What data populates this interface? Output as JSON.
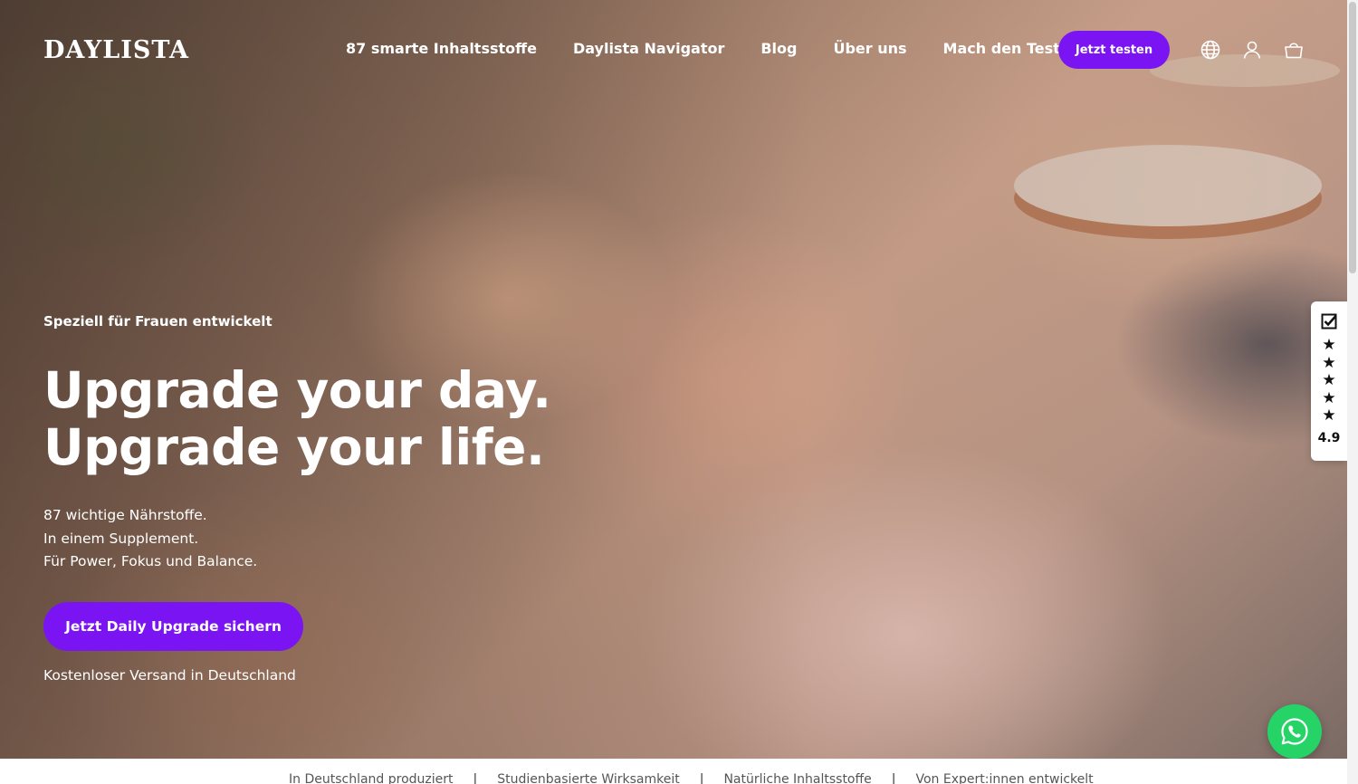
{
  "brand": {
    "logo_text": "DAYLISTA"
  },
  "nav": {
    "items": [
      {
        "label": "87 smarte Inhaltsstoffe"
      },
      {
        "label": "Daylista Navigator"
      },
      {
        "label": "Blog"
      },
      {
        "label": "Über uns"
      },
      {
        "label": "Mach den Test"
      }
    ],
    "cta_label": "Jetzt testen",
    "icons": [
      "globe-icon",
      "account-icon",
      "cart-icon"
    ]
  },
  "hero": {
    "eyebrow": "Speziell für Frauen entwickelt",
    "headline_line1": "Upgrade your day.",
    "headline_line2": "Upgrade your life.",
    "sub_line1": "87 wichtige Nährstoffe.",
    "sub_line2": "In einem Supplement.",
    "sub_line3": "Für Power, Fokus und Balance.",
    "cta_label": "Jetzt Daily Upgrade sichern",
    "shipping_note": "Kostenloser Versand in Deutschland"
  },
  "rating": {
    "score": "4.9",
    "stars": [
      "★",
      "★",
      "★",
      "★",
      "★"
    ],
    "badge_icon": "checkmark-badge-icon"
  },
  "usp": {
    "items": [
      {
        "label": "In Deutschland produziert"
      },
      {
        "label": "Studienbasierte Wirksamkeit"
      },
      {
        "label": "Natürliche Inhaltsstoffe"
      },
      {
        "label": "Von Expert:innen entwickelt"
      }
    ],
    "separator": "|"
  },
  "colors": {
    "accent": "#7b14f2",
    "whatsapp": "#25d366",
    "text_on_hero": "#ffffff"
  }
}
